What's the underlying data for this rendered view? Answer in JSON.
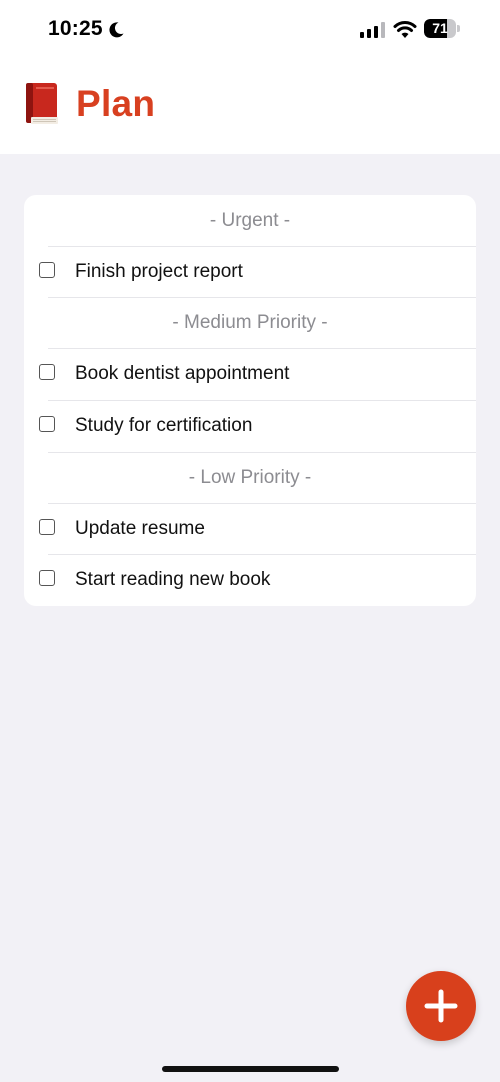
{
  "status_bar": {
    "time": "10:25",
    "battery_level": "71",
    "battery_fraction": 0.71
  },
  "header": {
    "icon": "book-icon",
    "title": "Plan"
  },
  "sections": [
    {
      "header": "- Urgent -",
      "tasks": [
        {
          "label": "Finish project report",
          "checked": false
        }
      ]
    },
    {
      "header": "- Medium Priority -",
      "tasks": [
        {
          "label": "Book dentist appointment",
          "checked": false
        },
        {
          "label": "Study for certification",
          "checked": false
        }
      ]
    },
    {
      "header": "- Low Priority -",
      "tasks": [
        {
          "label": "Update resume",
          "checked": false
        },
        {
          "label": "Start reading new book",
          "checked": false
        }
      ]
    }
  ],
  "fab": {
    "icon": "plus-icon"
  },
  "colors": {
    "accent": "#d8401c",
    "background": "#f2f1f6",
    "section_header_text": "#8c8c91"
  }
}
